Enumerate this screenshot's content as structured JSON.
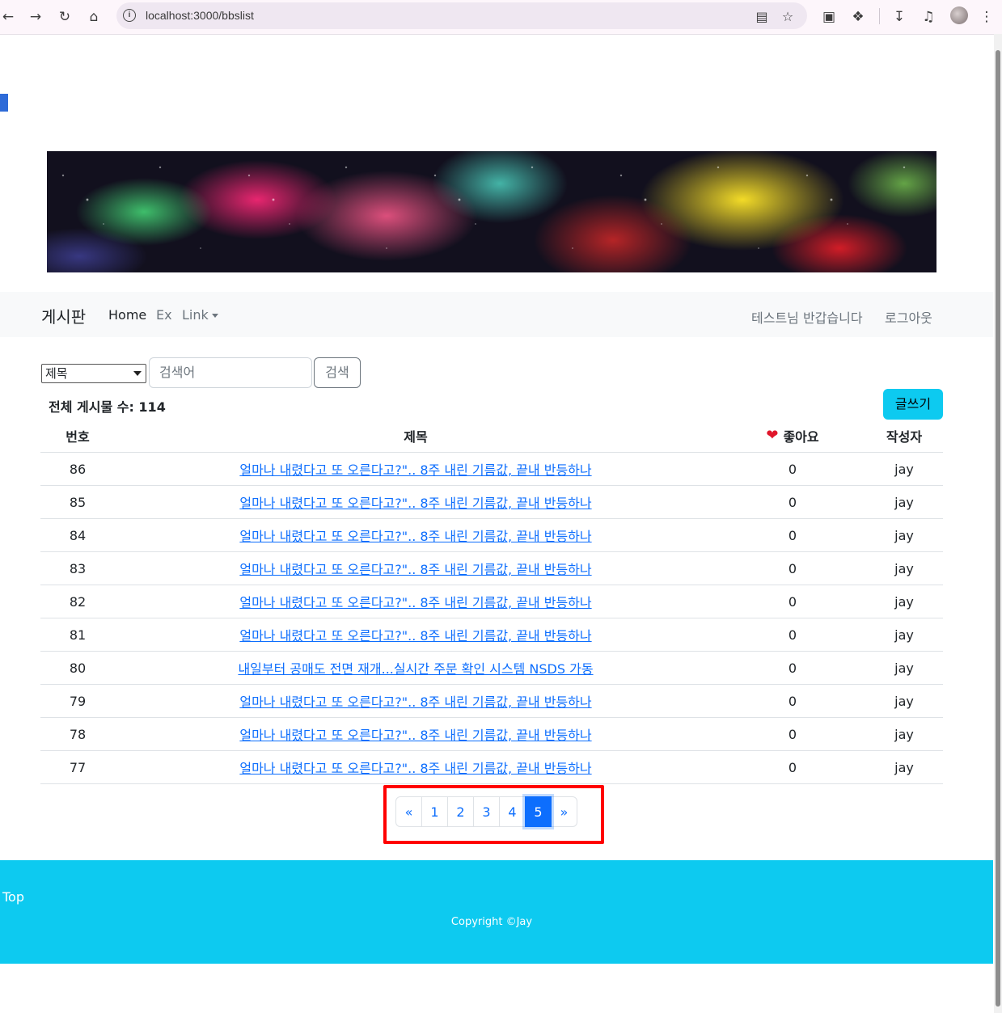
{
  "browser": {
    "url": "localhost:3000/bbslist",
    "icons": [
      "back-icon",
      "forward-icon",
      "reload-icon",
      "home-icon",
      "site-info-icon",
      "install-icon",
      "star-icon",
      "cast-icon",
      "extensions-icon",
      "download-icon",
      "media-icon",
      "profile-avatar",
      "menu-icon"
    ]
  },
  "navbar": {
    "brand": "게시판",
    "links": [
      "Home",
      "Ex",
      "Link"
    ],
    "greeting": "테스트님 반갑습니다",
    "logout": "로그아웃"
  },
  "search": {
    "select_value": "제목",
    "placeholder": "검색어",
    "button": "검색"
  },
  "summary": {
    "total_label": "전체 게시물 수: 114",
    "write_button": "글쓰기"
  },
  "table": {
    "headers": {
      "no": "번호",
      "title": "제목",
      "like": "좋아요",
      "author": "작성자"
    },
    "rows": [
      {
        "no": "86",
        "title": "얼마나 내렸다고 또 오른다고?\".. 8주 내린 기름값, 끝내 반등하나",
        "like": "0",
        "author": "jay"
      },
      {
        "no": "85",
        "title": "얼마나 내렸다고 또 오른다고?\".. 8주 내린 기름값, 끝내 반등하나",
        "like": "0",
        "author": "jay"
      },
      {
        "no": "84",
        "title": "얼마나 내렸다고 또 오른다고?\".. 8주 내린 기름값, 끝내 반등하나",
        "like": "0",
        "author": "jay"
      },
      {
        "no": "83",
        "title": "얼마나 내렸다고 또 오른다고?\".. 8주 내린 기름값, 끝내 반등하나",
        "like": "0",
        "author": "jay"
      },
      {
        "no": "82",
        "title": "얼마나 내렸다고 또 오른다고?\".. 8주 내린 기름값, 끝내 반등하나",
        "like": "0",
        "author": "jay"
      },
      {
        "no": "81",
        "title": "얼마나 내렸다고 또 오른다고?\".. 8주 내린 기름값, 끝내 반등하나",
        "like": "0",
        "author": "jay"
      },
      {
        "no": "80",
        "title": "내일부터 공매도 전면 재개...실시간 주문 확인 시스템 NSDS 가동",
        "like": "0",
        "author": "jay"
      },
      {
        "no": "79",
        "title": "얼마나 내렸다고 또 오른다고?\".. 8주 내린 기름값, 끝내 반등하나",
        "like": "0",
        "author": "jay"
      },
      {
        "no": "78",
        "title": "얼마나 내렸다고 또 오른다고?\".. 8주 내린 기름값, 끝내 반등하나",
        "like": "0",
        "author": "jay"
      },
      {
        "no": "77",
        "title": "얼마나 내렸다고 또 오른다고?\".. 8주 내린 기름값, 끝내 반등하나",
        "like": "0",
        "author": "jay"
      }
    ]
  },
  "pagination": {
    "prev": "«",
    "pages": [
      "1",
      "2",
      "3",
      "4",
      "5"
    ],
    "active": "5",
    "next": "»"
  },
  "footer": {
    "top_link": "Top",
    "copyright": "Copyright ©Jay"
  },
  "colors": {
    "accent": "#0dcaf0",
    "link": "#0d6efd",
    "highlight_box": "#ff0000"
  }
}
